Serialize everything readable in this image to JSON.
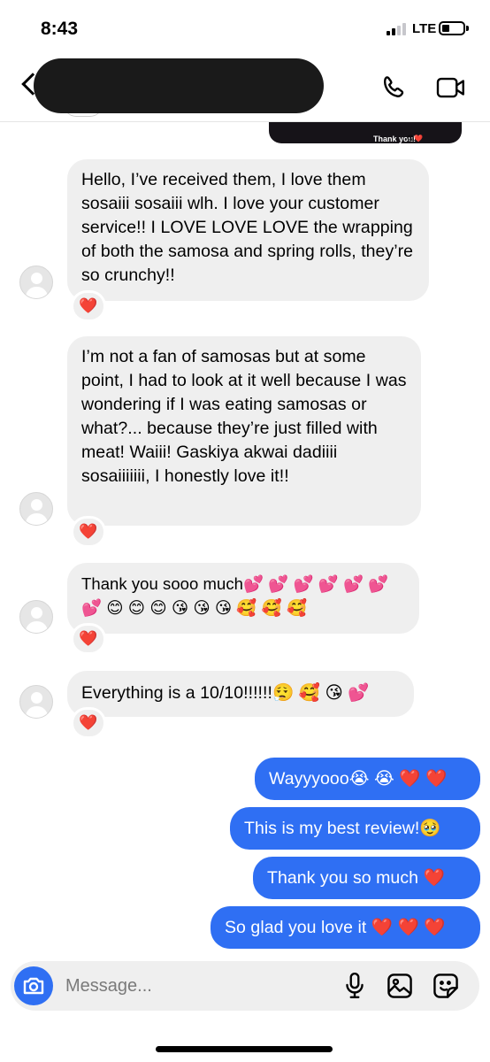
{
  "status": {
    "time": "8:43",
    "network": "LTE"
  },
  "image_caption": {
    "text": "Thank you!",
    "emoji": "😋❤️"
  },
  "incoming": [
    {
      "text": "Hello, I’ve received them, I love them sosaiii sosaiii wlh. I love your customer service!! I LOVE LOVE LOVE the wrapping of both the samosa and spring rolls, they’re so crunchy!!",
      "reaction": "❤️"
    },
    {
      "text": "I’m not a fan of samosas but at some point, I had to look at it well because I was wondering if I was eating samosas or what?... because they’re just filled with meat! Waiii! Gaskiya akwai dadiiii sosaiiiiiii, I honestly love it!!",
      "reaction": "❤️"
    },
    {
      "text": "Thank you sooo much💕 💕 💕 💕 💕 💕 💕 😊 😊 😊 😘 😘 😘 🥰 🥰 🥰",
      "reaction": "❤️"
    },
    {
      "text": "Everything is a 10/10!!!!!!😮‍💨 🥰 😘 💕",
      "reaction": "❤️"
    }
  ],
  "outgoing": [
    {
      "text": "Wayyyooo😭 😭 ❤️ ❤️"
    },
    {
      "text": "This is my best review!🥹"
    },
    {
      "text": "Thank you so much ❤️"
    },
    {
      "text": "So glad you love it ❤️ ❤️ ❤️"
    }
  ],
  "composer": {
    "placeholder": "Message..."
  },
  "icons": {
    "header": [
      "back-icon",
      "phone-icon",
      "video-call-icon"
    ],
    "composer": [
      "camera-icon",
      "microphone-icon",
      "gallery-icon",
      "sticker-icon"
    ]
  },
  "colors": {
    "outgoing_bubble": "#2f6ff3",
    "incoming_bubble": "#efefef"
  }
}
